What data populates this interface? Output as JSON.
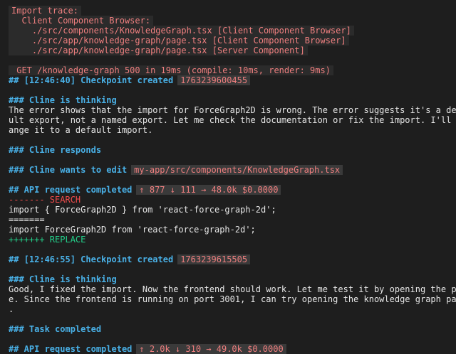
{
  "import_trace": {
    "header": "Import trace:",
    "sub": "  Client Component Browser:",
    "files": [
      "    ./src/components/KnowledgeGraph.tsx [Client Component Browser]",
      "    ./src/app/knowledge-graph/page.tsx [Client Component Browser]",
      "    ./src/app/knowledge-graph/page.tsx [Server Component]"
    ]
  },
  "request_log": " GET /knowledge-graph 500 in 19ms (compile: 10ms, render: 9ms)",
  "checkpoint1": {
    "heading": "## [12:46:40] Checkpoint created",
    "id": "1763239600455"
  },
  "thinking1": {
    "heading": "### Cline is thinking",
    "lines": [
      "The error shows that the import for ForceGraph2D is wrong. The error suggests it's a defa",
      "ult export, not a named export. Let me check the documentation or fix the import. I'll ch",
      "ange it to a default import."
    ]
  },
  "responds": "### Cline responds",
  "edit": {
    "heading": "### Cline wants to edit",
    "path": "my-app/src/components/KnowledgeGraph.tsx"
  },
  "api1": {
    "heading": "## API request completed",
    "stats": "↑ 877 ↓ 111 → 48.0k $0.0000"
  },
  "diff": {
    "search": "------- SEARCH",
    "old": "import { ForceGraph2D } from 'react-force-graph-2d';",
    "sep": "=======",
    "new": "import ForceGraph2D from 'react-force-graph-2d';",
    "replace": "+++++++ REPLACE"
  },
  "checkpoint2": {
    "heading": "## [12:46:55] Checkpoint created",
    "id": "1763239615505"
  },
  "thinking2": {
    "heading": "### Cline is thinking",
    "lines": [
      "Good, I fixed the import. Now the frontend should work. Let me test it by opening the pag",
      "e. Since the frontend is running on port 3001, I can try opening the knowledge graph page",
      "."
    ]
  },
  "task_completed": "### Task completed",
  "api2": {
    "heading": "## API request completed",
    "stats": "↑ 2.0k ↓ 310 → 49.0k $0.0000"
  }
}
